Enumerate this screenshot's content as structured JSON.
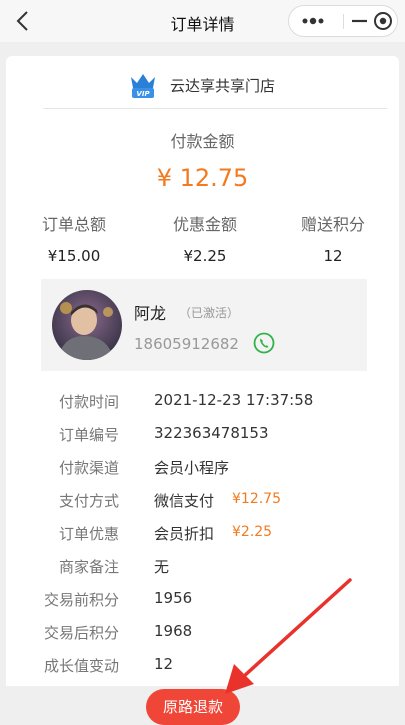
{
  "navbar": {
    "title": "订单详情",
    "back_icon": "chevron-left-icon",
    "more_icon": "more-dots-icon",
    "minimize_icon": "minimize-icon",
    "close_icon": "target-close-icon"
  },
  "store": {
    "icon": "vip-crown-icon",
    "vip_label": "VIP",
    "name": "云达享共享门店"
  },
  "payment": {
    "label": "付款金额",
    "amount": "¥ 12.75"
  },
  "stats": [
    {
      "label": "订单总额",
      "value": "¥15.00"
    },
    {
      "label": "优惠金额",
      "value": "¥2.25"
    },
    {
      "label": "赠送积分",
      "value": "12"
    }
  ],
  "member": {
    "name": "阿龙",
    "status": "（已激活）",
    "phone": "18605912682",
    "call_icon": "phone-icon"
  },
  "details": [
    {
      "key": "付款时间",
      "value": "2021-12-23 17:37:58"
    },
    {
      "key": "订单编号",
      "value": "322363478153"
    },
    {
      "key": "付款渠道",
      "value": "会员小程序"
    },
    {
      "key": "支付方式",
      "value": "微信支付",
      "extra": "¥12.75"
    },
    {
      "key": "订单优惠",
      "value": "会员折扣",
      "extra": "¥2.25"
    },
    {
      "key": "商家备注",
      "value": "无"
    },
    {
      "key": "交易前积分",
      "value": "1956"
    },
    {
      "key": "交易后积分",
      "value": "1968"
    },
    {
      "key": "成长值变动",
      "value": "12"
    }
  ],
  "actions": {
    "refund_label": "原路退款"
  },
  "colors": {
    "accent_orange": "#f37a1f",
    "refund_red": "#ef4638",
    "arrow_red": "#e8322b",
    "phone_green": "#2fb34a",
    "vip_blue": "#2a7fd6"
  }
}
